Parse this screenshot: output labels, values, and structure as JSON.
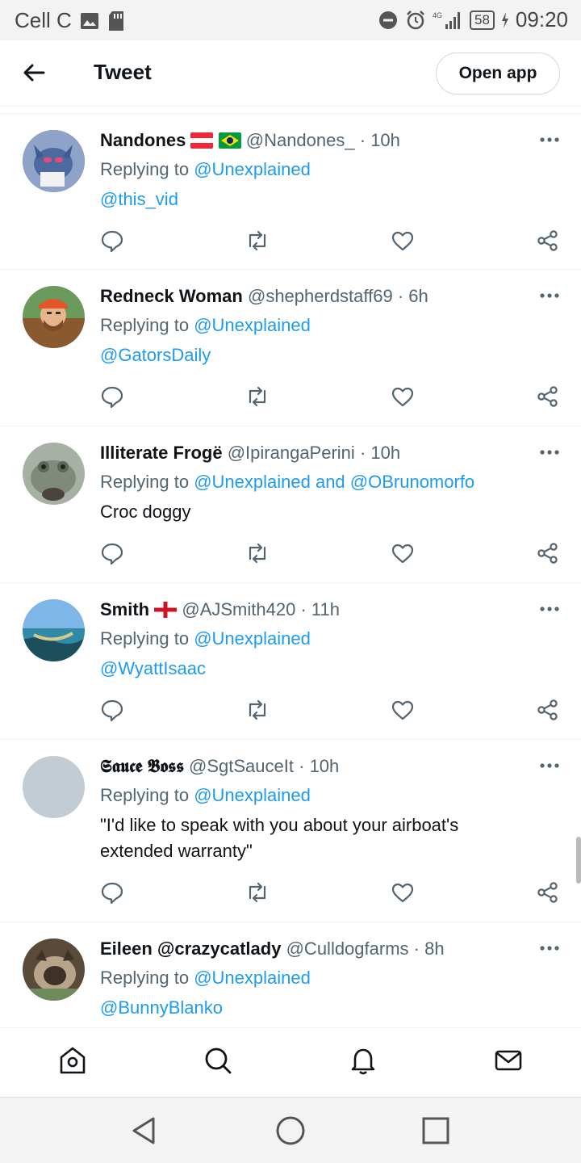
{
  "status_bar": {
    "carrier": "Cell C",
    "network": "4G",
    "battery": "58",
    "time": "09:20"
  },
  "header": {
    "title": "Tweet",
    "open_app_label": "Open app"
  },
  "tweets": [
    {
      "name": "Nandones",
      "handle": "@Nandones_",
      "time": "10h",
      "replying_prefix": "Replying to",
      "replying_to": "@Unexplained",
      "body": "@this_vid",
      "avatar_color": "#5b6b8c"
    },
    {
      "name": "Redneck Woman",
      "handle": "@shepherdstaff69",
      "time": "6h",
      "replying_prefix": "Replying to",
      "replying_to": "@Unexplained",
      "body": "@GatorsDaily",
      "avatar_color": "#c47a3a"
    },
    {
      "name": "Illiterate Frogë",
      "handle": "@IpirangaPerini",
      "time": "10h",
      "replying_prefix": "Replying to",
      "replying_to": "@Unexplained and @OBrunomorfo",
      "body": "Croc doggy",
      "avatar_color": "#8a9486"
    },
    {
      "name": "Smith",
      "handle": "@AJSmith420",
      "time": "11h",
      "replying_prefix": "Replying to",
      "replying_to": "@Unexplained",
      "body": "@WyattIsaac",
      "avatar_color": "#5c8fc0"
    },
    {
      "name": "𝕾𝖆𝖚𝖈𝖊 𝕭𝖔𝖘𝖘",
      "handle": "@SgtSauceIt",
      "time": "10h",
      "replying_prefix": "Replying to",
      "replying_to": "@Unexplained",
      "body": "\"I'd like to speak with you about your airboat's extended warranty\"",
      "avatar_color": "#c1ccd4"
    },
    {
      "name": "Eileen @crazycatlady",
      "handle": "@Culldogfarms",
      "time": "8h",
      "replying_prefix": "Replying to",
      "replying_to": "@Unexplained",
      "body": "@BunnyBlanko",
      "avatar_color": "#6b5a48"
    }
  ],
  "colors": {
    "accent": "#1d9bf0",
    "muted_text": "#536471",
    "divider": "#eff3f4"
  },
  "icons": {
    "reply": "reply-icon",
    "retweet": "retweet-icon",
    "like": "like-icon",
    "share": "share-icon",
    "more": "more-icon"
  }
}
